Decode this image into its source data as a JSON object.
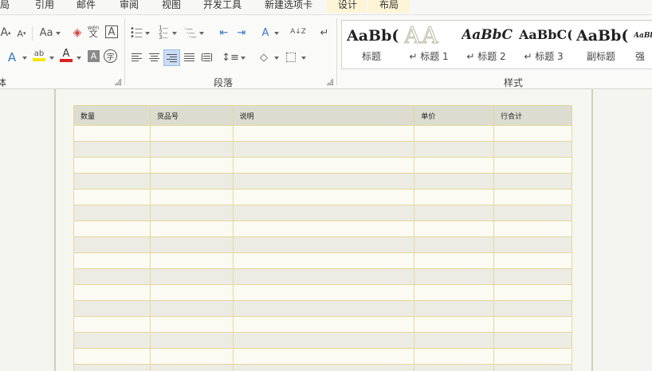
{
  "tabs": [
    {
      "id": "layout-partial",
      "label": "布局",
      "contextual": false
    },
    {
      "id": "references",
      "label": "引用",
      "contextual": false
    },
    {
      "id": "mailings",
      "label": "邮件",
      "contextual": false
    },
    {
      "id": "review",
      "label": "审阅",
      "contextual": false
    },
    {
      "id": "view",
      "label": "视图",
      "contextual": false
    },
    {
      "id": "developer",
      "label": "开发工具",
      "contextual": false
    },
    {
      "id": "new-tab",
      "label": "新建选项卡",
      "contextual": false
    },
    {
      "id": "design",
      "label": "设计",
      "contextual": true
    },
    {
      "id": "table-layout",
      "label": "布局",
      "contextual": true
    }
  ],
  "ribbon": {
    "font_group_label_partial": "体",
    "paragraph_group_label": "段落",
    "styles_group_label": "样式",
    "font_glyphs": {
      "grow": "A",
      "shrink": "A",
      "change_case": "Aa",
      "phonetic_top": "wén",
      "phonetic_bottom": "文",
      "char_border": "A",
      "text_effect": "A",
      "highlight": "ab",
      "font_color": "A",
      "char_shading": "A",
      "enclose": "字"
    },
    "paragraph_glyphs": {
      "chinese_layout": "A",
      "sort": "A↓Z"
    },
    "styles": [
      {
        "sample": "AaBb(",
        "name": "标题"
      },
      {
        "sample": "AA",
        "name": "↵ 标题 1"
      },
      {
        "sample": "AaBbC",
        "name": "↵ 标题 2"
      },
      {
        "sample": "AaBbC(",
        "name": "↵ 标题 3"
      },
      {
        "sample": "AaBb(",
        "name": "副标题"
      },
      {
        "sample": "AaBbC",
        "name": "强"
      }
    ]
  },
  "colors": {
    "highlight": "#f5e600",
    "font_color": "#e02020",
    "table_border": "#e6d79a",
    "header_bg": "#dcdcd0",
    "contextual_tab": "#fdf5d6"
  },
  "table": {
    "headers": [
      "数量",
      "货品号",
      "说明",
      "单价",
      "行合计"
    ],
    "rows": [
      [
        "",
        "",
        "",
        "",
        ""
      ],
      [
        "",
        "",
        "",
        "",
        ""
      ],
      [
        "",
        "",
        "",
        "",
        ""
      ],
      [
        "",
        "",
        "",
        "",
        ""
      ],
      [
        "",
        "",
        "",
        "",
        ""
      ],
      [
        "",
        "",
        "",
        "",
        ""
      ],
      [
        "",
        "",
        "",
        "",
        ""
      ],
      [
        "",
        "",
        "",
        "",
        ""
      ],
      [
        "",
        "",
        "",
        "",
        ""
      ],
      [
        "",
        "",
        "",
        "",
        ""
      ],
      [
        "",
        "",
        "",
        "",
        ""
      ],
      [
        "",
        "",
        "",
        "",
        ""
      ],
      [
        "",
        "",
        "",
        "",
        ""
      ],
      [
        "",
        "",
        "",
        "",
        ""
      ],
      [
        "",
        "",
        "",
        "",
        ""
      ],
      [
        "",
        "",
        "",
        "",
        ""
      ]
    ]
  }
}
